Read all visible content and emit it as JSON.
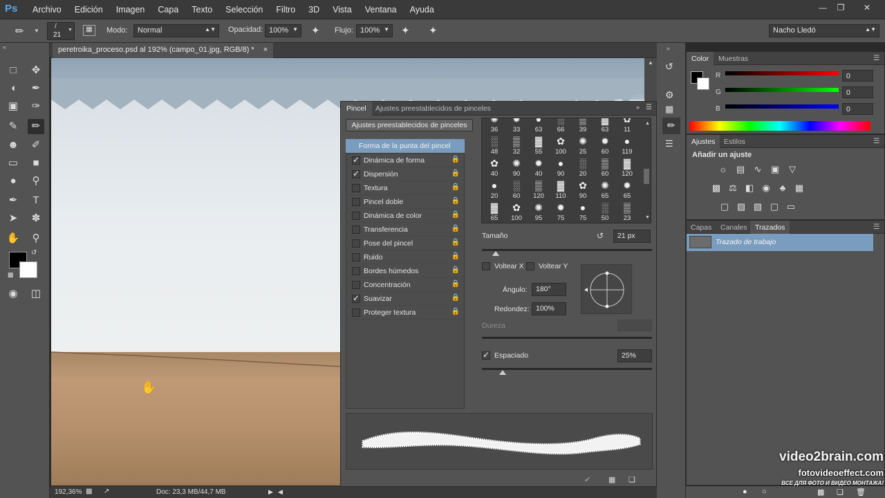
{
  "app": {
    "logo": "Ps",
    "menus": [
      "Archivo",
      "Edición",
      "Imagen",
      "Capa",
      "Texto",
      "Selección",
      "Filtro",
      "3D",
      "Vista",
      "Ventana",
      "Ayuda"
    ]
  },
  "options": {
    "brush_size": "21",
    "mode_label": "Modo:",
    "mode_value": "Normal",
    "opacity_label": "Opacidad:",
    "opacity_value": "100%",
    "flow_label": "Flujo:",
    "flow_value": "100%",
    "workspace": "Nacho Lledó"
  },
  "document": {
    "tab_title": "peretroika_proceso.psd al 192% (campo_01.jpg, RGB/8) *",
    "close": "×",
    "zoom": "192,36%",
    "doc_info": "Doc: 23,3 MB/44,7 MB"
  },
  "brush_panel": {
    "tab_brush": "Pincel",
    "tab_presets": "Ajustes preestablecidos de pinceles",
    "presets_button": "Ajustes preestablecidos de pinceles",
    "tip_shape": "Forma de la punta del pincel",
    "options": [
      {
        "label": "Dinámica de forma",
        "checked": true
      },
      {
        "label": "Dispersión",
        "checked": true
      },
      {
        "label": "Textura",
        "checked": false
      },
      {
        "label": "Pincel doble",
        "checked": false
      },
      {
        "label": "Dinámica de color",
        "checked": false
      },
      {
        "label": "Transferencia",
        "checked": false
      },
      {
        "label": "Pose del pincel",
        "checked": false
      },
      {
        "label": "Ruido",
        "checked": false
      },
      {
        "label": "Bordes húmedos",
        "checked": false
      },
      {
        "label": "Concentración",
        "checked": false
      },
      {
        "label": "Suavizar",
        "checked": true
      },
      {
        "label": "Proteger textura",
        "checked": false
      }
    ],
    "tips": [
      [
        "36",
        "33",
        "63",
        "66",
        "39",
        "63",
        "11"
      ],
      [
        "48",
        "32",
        "55",
        "100",
        "25",
        "60",
        "119"
      ],
      [
        "40",
        "90",
        "40",
        "90",
        "20",
        "60",
        "120"
      ],
      [
        "20",
        "60",
        "120",
        "110",
        "90",
        "65",
        "65"
      ],
      [
        "65",
        "100",
        "95",
        "75",
        "75",
        "50",
        "23"
      ]
    ],
    "size_label": "Tamaño",
    "size_value": "21 px",
    "size_level": 0.08,
    "flip_x": "Voltear X",
    "flip_y": "Voltear Y",
    "angle_label": "Ángulo:",
    "angle_value": "180°",
    "roundness_label": "Redondez:",
    "roundness_value": "100%",
    "hardness_label": "Dureza",
    "spacing_label": "Espaciado",
    "spacing_checked": true,
    "spacing_value": "25%",
    "spacing_level": 0.12
  },
  "color_panel": {
    "tab_color": "Color",
    "tab_swatches": "Muestras",
    "r_label": "R",
    "r_value": "0",
    "g_label": "G",
    "g_value": "0",
    "b_label": "B",
    "b_value": "0"
  },
  "adjust_panel": {
    "tab_adjust": "Ajustes",
    "tab_styles": "Estilos",
    "heading": "Añadir un ajuste"
  },
  "paths_panel": {
    "tab_layers": "Capas",
    "tab_channels": "Canales",
    "tab_paths": "Trazados",
    "path_name": "Trazado de trabajo"
  },
  "watermark": {
    "line1": "video2brain.com",
    "line2": "fotovideoeffect.com",
    "line3": "ВСЕ ДЛЯ ФОТО И ВИДЕО МОНТАЖА!"
  },
  "colors": {
    "ps_blue": "#5aa7e6",
    "panel_bg": "#535353",
    "selected_row": "#7a9dbf"
  }
}
